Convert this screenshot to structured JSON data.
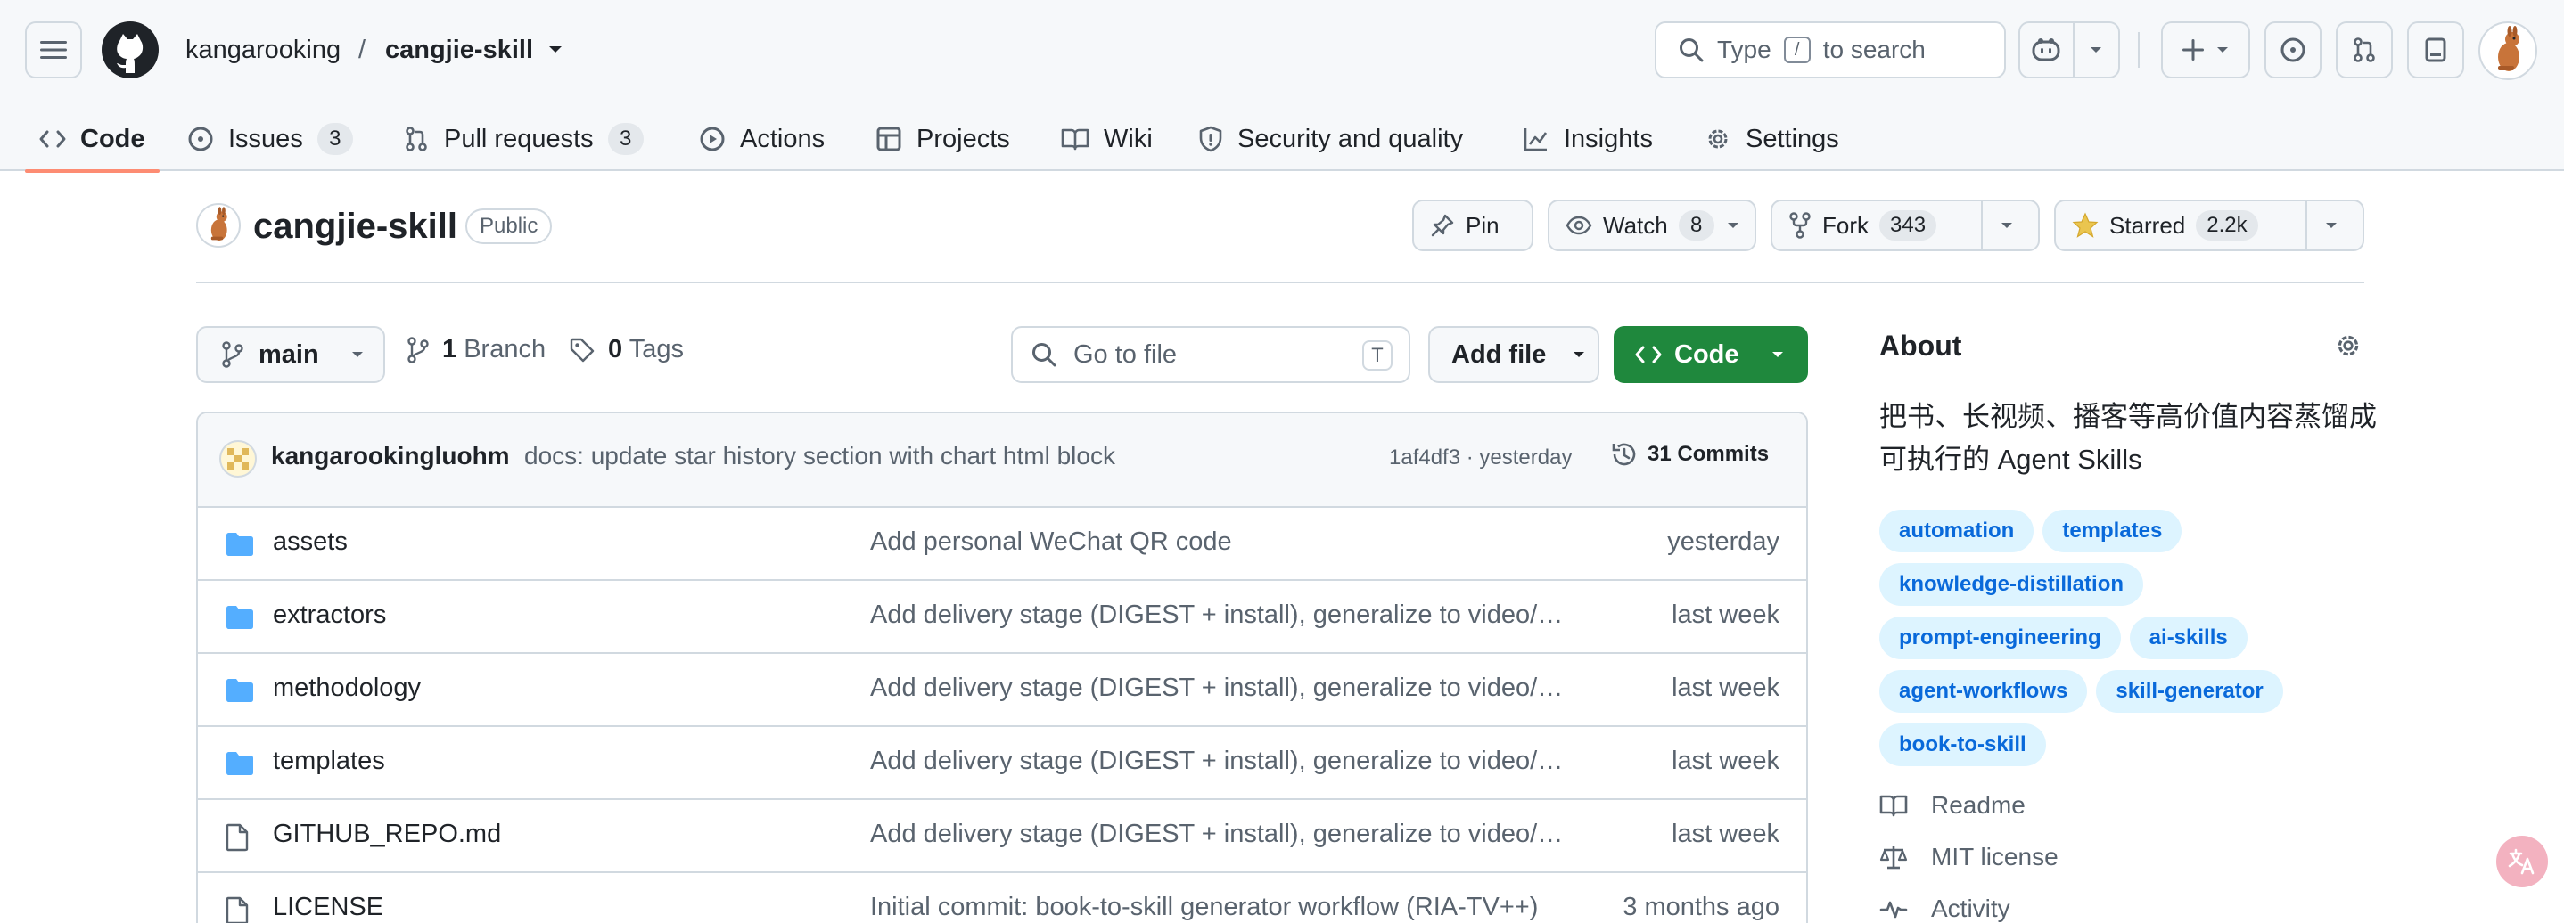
{
  "header": {
    "owner": "kangarooking",
    "separator": "/",
    "repo": "cangjie-skill",
    "search_prefix": "Type",
    "search_key": "/",
    "search_suffix": "to search"
  },
  "tabs": [
    {
      "label": "Code",
      "icon": "code-icon"
    },
    {
      "label": "Issues",
      "count": "3",
      "icon": "issue-icon"
    },
    {
      "label": "Pull requests",
      "count": "3",
      "icon": "pull-request-icon"
    },
    {
      "label": "Actions",
      "icon": "play-icon"
    },
    {
      "label": "Projects",
      "icon": "table-icon"
    },
    {
      "label": "Wiki",
      "icon": "book-icon"
    },
    {
      "label": "Security and quality",
      "icon": "shield-icon"
    },
    {
      "label": "Insights",
      "icon": "graph-icon"
    },
    {
      "label": "Settings",
      "icon": "gear-icon"
    }
  ],
  "repo": {
    "name": "cangjie-skill",
    "visibility": "Public",
    "pin_label": "Pin",
    "watch_label": "Watch",
    "watch_count": "8",
    "fork_label": "Fork",
    "fork_count": "343",
    "star_label": "Starred",
    "star_count": "2.2k"
  },
  "toolbar": {
    "branch": "main",
    "branch_count": "1",
    "branch_label": "Branch",
    "tag_count": "0",
    "tag_label": "Tags",
    "goto_placeholder": "Go to file",
    "goto_key": "T",
    "add_file": "Add file",
    "code": "Code"
  },
  "commit": {
    "author": "kangarookingluohm",
    "message": "docs: update star history section with chart html block",
    "hash_time": "1af4df3 · yesterday",
    "count_label": "31 Commits"
  },
  "files": [
    {
      "name": "assets",
      "type": "folder",
      "message": "Add personal WeChat QR code",
      "time": "yesterday"
    },
    {
      "name": "extractors",
      "type": "folder",
      "message": "Add delivery stage (DIGEST + install), generalize to video/podcast",
      "time": "last week"
    },
    {
      "name": "methodology",
      "type": "folder",
      "message": "Add delivery stage (DIGEST + install), generalize to video/podcast",
      "time": "last week"
    },
    {
      "name": "templates",
      "type": "folder",
      "message": "Add delivery stage (DIGEST + install), generalize to video/podcast",
      "time": "last week"
    },
    {
      "name": "GITHUB_REPO.md",
      "type": "file",
      "message": "Add delivery stage (DIGEST + install), generalize to video/podcast",
      "time": "last week"
    },
    {
      "name": "LICENSE",
      "type": "file",
      "message": "Initial commit: book-to-skill generator workflow (RIA-TV++)",
      "time": "3 months ago"
    }
  ],
  "about": {
    "heading": "About",
    "description": "把书、长视频、播客等高价值内容蒸馏成可执行的 Agent Skills",
    "topics": [
      "automation",
      "templates",
      "knowledge-distillation",
      "prompt-engineering",
      "ai-skills",
      "agent-workflows",
      "skill-generator",
      "book-to-skill"
    ],
    "links": [
      {
        "label": "Readme",
        "icon": "book-icon"
      },
      {
        "label": "MIT license",
        "icon": "law-icon"
      },
      {
        "label": "Activity",
        "icon": "pulse-icon"
      }
    ]
  },
  "colors": {
    "accent_green": "#1f883d",
    "tab_underline": "#fd8c73",
    "topic_bg": "#ddf4ff",
    "topic_fg": "#0969da",
    "folder": "#54aeff"
  }
}
